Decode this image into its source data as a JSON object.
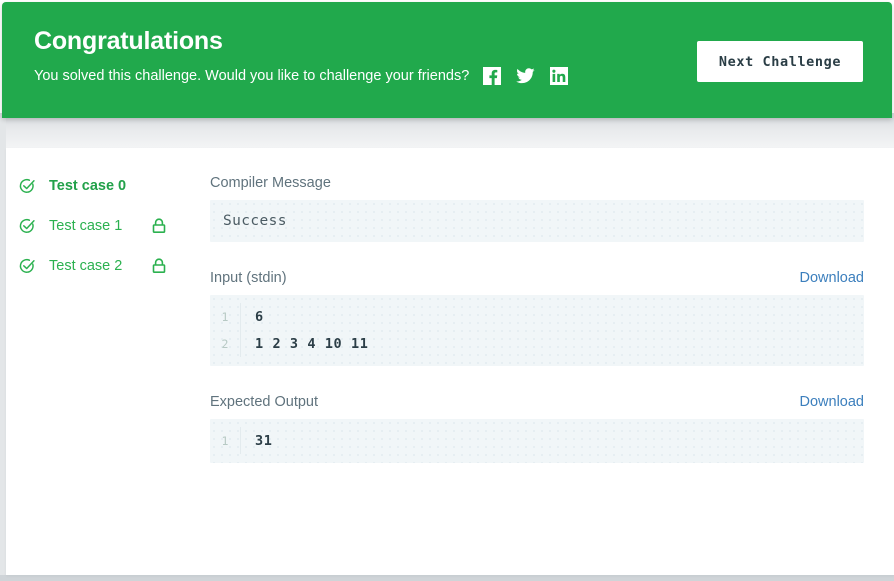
{
  "banner": {
    "title": "Congratulations",
    "subtitle": "You solved this challenge. Would you like to challenge your friends?",
    "next_button_label": "Next Challenge",
    "background_color": "#21a94c",
    "social": [
      {
        "name": "facebook-share-icon",
        "label": "Facebook"
      },
      {
        "name": "twitter-share-icon",
        "label": "Twitter"
      },
      {
        "name": "linkedin-share-icon",
        "label": "LinkedIn"
      }
    ]
  },
  "testcases": [
    {
      "label": "Test case 0",
      "status": "passed",
      "locked": false,
      "selected": true
    },
    {
      "label": "Test case 1",
      "status": "passed",
      "locked": true,
      "selected": false
    },
    {
      "label": "Test case 2",
      "status": "passed",
      "locked": true,
      "selected": false
    }
  ],
  "sections": {
    "compiler": {
      "label": "Compiler Message",
      "value": "Success"
    },
    "input": {
      "label": "Input (stdin)",
      "download_label": "Download",
      "lines": [
        {
          "number": "1",
          "text": "6"
        },
        {
          "number": "2",
          "text": "1 2 3 4 10 11"
        }
      ]
    },
    "expected": {
      "label": "Expected Output",
      "download_label": "Download",
      "lines": [
        {
          "number": "1",
          "text": "31"
        }
      ]
    }
  },
  "colors": {
    "accent_green": "#21a94c",
    "success_text": "#2bb14f",
    "link_blue": "#3c7fbd",
    "code_background": "#f1f6f8",
    "label_gray": "#60737d"
  }
}
